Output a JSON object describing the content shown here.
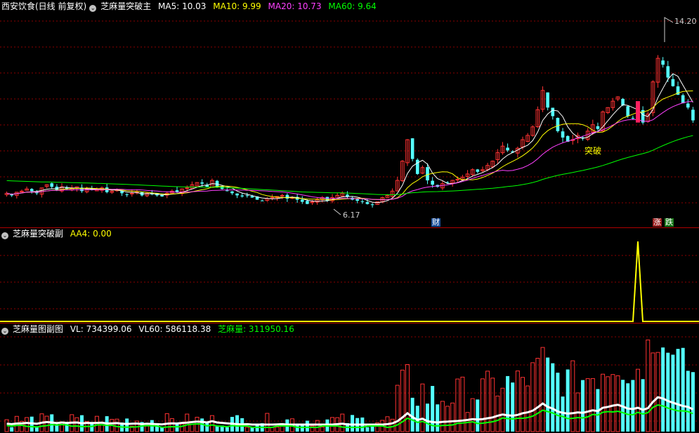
{
  "main": {
    "stock_name": "西安饮食(日线 前复权)",
    "indicator": "芝麻量突破主",
    "ma": [
      {
        "label": "MA5: 10.03",
        "color": "#ffffff"
      },
      {
        "label": "MA10: 9.99",
        "color": "#ffff00"
      },
      {
        "label": "MA20: 10.73",
        "color": "#ff40ff"
      },
      {
        "label": "MA60: 9.64",
        "color": "#00ff00"
      }
    ],
    "high_label": "14.20",
    "low_label": "6.17",
    "signal_label": "突破",
    "markers": {
      "cai": "财",
      "zhang": "涨",
      "die": "跌"
    }
  },
  "sub": {
    "indicator": "芝麻量突破副",
    "value_label": "AA4: 0.00"
  },
  "vol": {
    "indicator": "芝麻量图副图",
    "vl_label": "VL: 734399.06",
    "vl60_label": "VL60: 586118.38",
    "zml_label": "芝麻量: 311950.16"
  },
  "colors": {
    "up": "#ff3232",
    "down": "#54ffff",
    "grid": "#8b0000",
    "ma5": "#ffffff",
    "ma10": "#ffff00",
    "ma20": "#ff40ff",
    "ma60": "#00ff00"
  },
  "chart_data": {
    "type": "candlestick",
    "price_range": [
      5.5,
      15.0
    ],
    "closes": [
      6.7,
      6.6,
      6.75,
      6.8,
      6.9,
      6.8,
      6.7,
      6.95,
      7.1,
      7.0,
      6.85,
      7.0,
      6.9,
      6.95,
      7.0,
      6.8,
      6.9,
      6.85,
      6.9,
      6.95,
      6.75,
      6.8,
      6.85,
      6.7,
      6.65,
      6.7,
      6.75,
      6.6,
      6.7,
      6.65,
      6.6,
      6.55,
      6.7,
      6.8,
      6.75,
      6.9,
      6.95,
      7.1,
      7.2,
      7.15,
      7.0,
      7.3,
      7.0,
      6.9,
      6.8,
      6.7,
      6.6,
      6.55,
      6.6,
      6.5,
      6.4,
      6.35,
      6.45,
      6.5,
      6.55,
      6.6,
      6.45,
      6.5,
      6.4,
      6.3,
      6.2,
      6.3,
      6.4,
      6.5,
      6.35,
      6.5,
      6.6,
      6.7,
      6.55,
      6.4,
      6.35,
      6.3,
      6.2,
      6.17,
      6.3,
      6.5,
      6.6,
      6.8,
      7.3,
      8.2,
      9.2,
      8.3,
      7.6,
      7.9,
      7.3,
      7.1,
      7.0,
      7.15,
      7.2,
      7.3,
      7.35,
      7.45,
      7.6,
      7.8,
      7.7,
      7.8,
      8.0,
      8.2,
      8.6,
      8.9,
      8.7,
      8.6,
      8.8,
      9.2,
      9.4,
      9.8,
      10.6,
      11.5,
      10.7,
      10.3,
      9.6,
      9.3,
      9.1,
      9.2,
      9.4,
      9.3,
      9.6,
      9.9,
      9.7,
      10.5,
      10.7,
      11.0,
      11.2,
      10.8,
      10.3,
      10.2,
      10.5,
      10.0,
      10.4,
      11.9,
      13.0,
      12.7,
      12.1,
      11.7,
      11.3,
      10.9,
      10.7,
      10.1
    ]
  }
}
